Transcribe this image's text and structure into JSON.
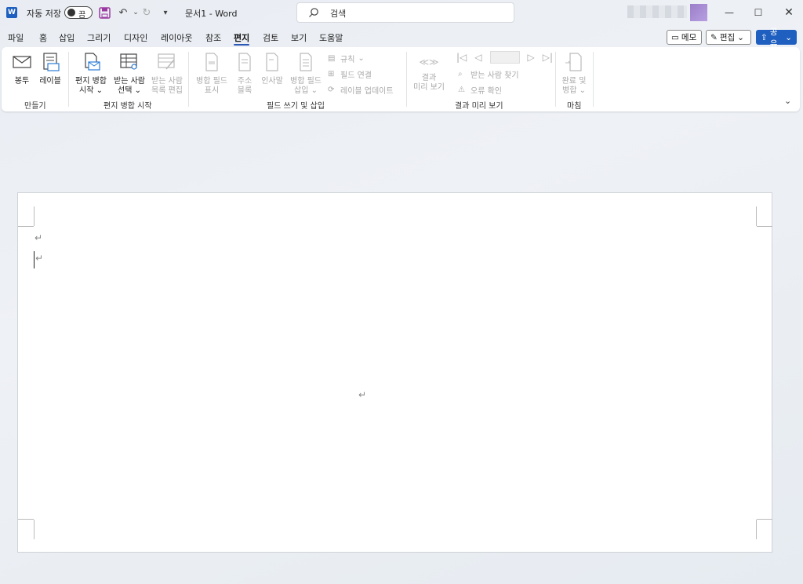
{
  "titlebar": {
    "autosave_label": "자동 저장",
    "autosave_state": "끔",
    "doc_title": "문서1  -  Word",
    "search_placeholder": "검색"
  },
  "tabs": [
    "파일",
    "홈",
    "삽입",
    "그리기",
    "디자인",
    "레이아웃",
    "참조",
    "편지",
    "검토",
    "보기",
    "도움말"
  ],
  "active_tab": "편지",
  "right_buttons": {
    "comments": "메모",
    "editing": "편집",
    "share": "공유"
  },
  "ribbon": {
    "groups": [
      "만들기",
      "편지 병합 시작",
      "필드 쓰기 및 삽입",
      "결과 미리 보기",
      "마침"
    ],
    "create": {
      "envelope": "봉투",
      "labels": "레이블"
    },
    "start_merge": {
      "start_l1": "편지 병합",
      "start_l2": "시작",
      "recipients_l1": "받는 사람",
      "recipients_l2": "선택",
      "edit_l1": "받는 사람",
      "edit_l2": "목록 편집"
    },
    "fields": {
      "highlight_l1": "병합 필드",
      "highlight_l2": "표시",
      "address_l1": "주소",
      "address_l2": "블록",
      "greeting": "인사말",
      "insert_l1": "병합 필드",
      "insert_l2": "삽입",
      "rules": "규칙",
      "match": "필드 연결",
      "update": "레이블 업데이트"
    },
    "preview": {
      "preview_l1": "결과",
      "preview_l2": "미리 보기",
      "find": "받는 사람 찾기",
      "check": "오류 확인"
    },
    "finish": {
      "finish_l1": "완료 및",
      "finish_l2": "병합"
    }
  },
  "icons": {
    "undo": "undo-icon",
    "redo": "redo-icon",
    "save": "save-icon"
  },
  "colors": {
    "accent": "#2b57b5",
    "share": "#1f5fbf",
    "save_icon": "#9a3aa0"
  },
  "document": {
    "paragraph_mark": "↵"
  }
}
